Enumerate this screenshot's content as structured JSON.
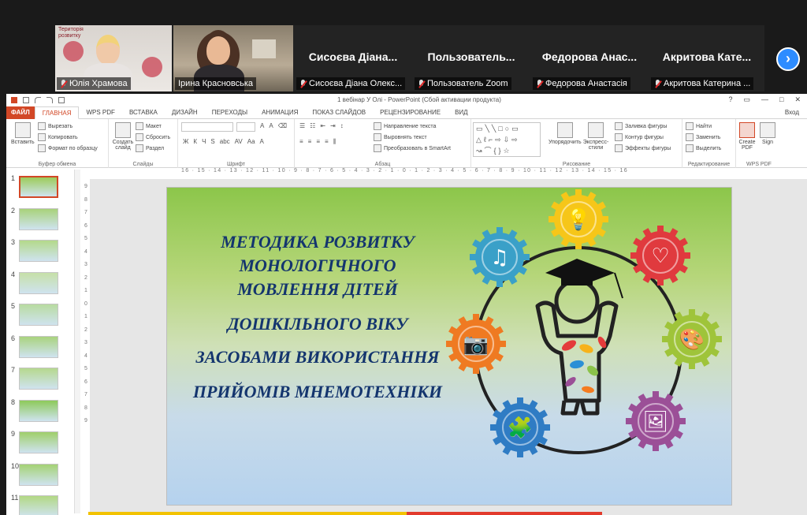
{
  "zoom": {
    "participants": [
      {
        "name": "Юлія Храмова",
        "muted": true,
        "video": true
      },
      {
        "name": "Ірина Красновська",
        "muted": false,
        "video": true,
        "active": true
      },
      {
        "big_name": "Сисоєва  Діана...",
        "name": "Сисоєва Діана Олекс...",
        "muted": true
      },
      {
        "big_name": "Пользователь...",
        "name": "Пользователь Zoom",
        "muted": true
      },
      {
        "big_name": "Федорова  Анас...",
        "name": "Федорова Анастасія",
        "muted": true
      },
      {
        "big_name": "Акритова  Кате...",
        "name": "Акритова Катерина ...",
        "muted": true
      }
    ],
    "video1_sign": "Територія\nрозвитку",
    "next_icon": "chevron-right-icon"
  },
  "ppt": {
    "title": "1 вебінар У Олі - PowerPoint (Сбой активации продукта)",
    "window_controls": [
      "?",
      "▭",
      "—",
      "□",
      "✕"
    ],
    "login": "Вход",
    "tabs": [
      "ФАЙЛ",
      "ГЛАВНАЯ",
      "WPS PDF",
      "ВСТАВКА",
      "ДИЗАЙН",
      "ПЕРЕХОДЫ",
      "АНИМАЦИЯ",
      "ПОКАЗ СЛАЙДОВ",
      "РЕЦЕНЗИРОВАНИЕ",
      "ВИД"
    ],
    "active_tab": "ГЛАВНАЯ",
    "ribbon": {
      "clipboard": {
        "paste": "Вставить",
        "cut": "Вырезать",
        "copy": "Копировать",
        "format_painter": "Формат по образцу",
        "label": "Буфер обмена"
      },
      "slides": {
        "new_slide": "Создать слайд",
        "layout": "Макет",
        "reset": "Сбросить",
        "section": "Раздел",
        "label": "Слайды"
      },
      "font": {
        "label": "Шрифт",
        "buttons": [
          "Ж",
          "К",
          "Ч",
          "S",
          "abc",
          "AV",
          "Aa",
          "A"
        ]
      },
      "paragraph": {
        "text_direction": "Направление текста",
        "align_text": "Выровнять текст",
        "smartart": "Преобразовать в SmartArt",
        "label": "Абзац"
      },
      "drawing": {
        "arrange": "Упорядочить",
        "quick_styles": "Экспресс-стили",
        "fill": "Заливка фигуры",
        "outline": "Контур фигуры",
        "effects": "Эффекты фигуры",
        "label": "Рисование",
        "shapes": "▭╲╲□○▭ △ℓ⌐⇨⇩⇨ ↝⌒{}☆"
      },
      "editing": {
        "find": "Найти",
        "replace": "Заменить",
        "select": "Выделить",
        "label": "Редактирование"
      },
      "wps": {
        "create_pdf": "Create PDF",
        "sign": "Sign",
        "label": "WPS PDF"
      }
    },
    "ruler": "16 · 15 · 14 · 13 · 12 · 11 · 10 · 9 · 8 · 7 · 6 · 5 · 4 · 3 · 2 · 1 · 0 · 1 · 2 · 3 · 4 · 5 · 6 · 7 · 8 · 9 · 10 · 11 · 12 · 13 · 14 · 15 · 16",
    "vruler": [
      "9",
      "8",
      "7",
      "6",
      "5",
      "4",
      "3",
      "2",
      "1",
      "0",
      "1",
      "2",
      "3",
      "4",
      "5",
      "6",
      "7",
      "8",
      "9"
    ],
    "thumbnails": [
      "1",
      "2",
      "3",
      "4",
      "5",
      "6",
      "7",
      "8",
      "9",
      "10",
      "11"
    ],
    "selected_slide": "1",
    "slide": {
      "lines": [
        "МЕТОДИКА РОЗВИТКУ",
        "МОНОЛОГІЧНОГО",
        "МОВЛЕННЯ ДІТЕЙ",
        "ДОШКІЛЬНОГО ВІКУ",
        "ЗАСОБАМИ ВИКОРИСТАННЯ",
        "ПРИЙОМІВ МНЕМОТЕХНІКИ"
      ],
      "text_color": "#14356e",
      "gear_icons": [
        {
          "icon": "lightbulb-icon",
          "color": "#f6c619"
        },
        {
          "icon": "heart-icon",
          "color": "#e03a3e"
        },
        {
          "icon": "palette-icon",
          "color": "#9fc43a"
        },
        {
          "icon": "picture-icon",
          "color": "#9b4f97"
        },
        {
          "icon": "puzzle-icon",
          "color": "#2f7cc4"
        },
        {
          "icon": "camera-icon",
          "color": "#ef7a22"
        },
        {
          "icon": "music-note-icon",
          "color": "#3aa0c8"
        }
      ]
    },
    "accent": "#d24726"
  }
}
